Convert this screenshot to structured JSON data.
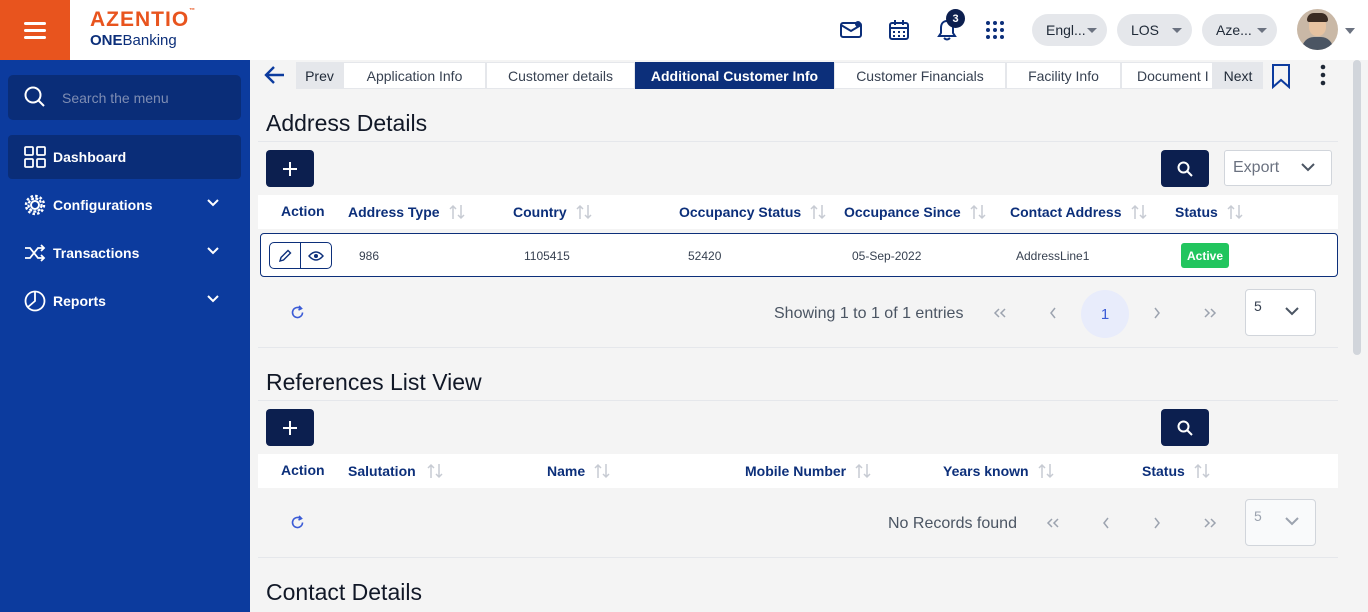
{
  "brand": {
    "logo": "AZENTIO",
    "tm": "™",
    "sub_bold": "ONE",
    "sub_rest": "Banking"
  },
  "header": {
    "notification_count": "3",
    "language": "Engl...",
    "module": "LOS",
    "entity": "Aze..."
  },
  "sidebar": {
    "search_placeholder": "Search the menu",
    "items": [
      {
        "label": "Dashboard"
      },
      {
        "label": "Configurations"
      },
      {
        "label": "Transactions"
      },
      {
        "label": "Reports"
      }
    ]
  },
  "tabs": {
    "prev": "Prev",
    "next": "Next",
    "items": [
      {
        "label": "Application Info"
      },
      {
        "label": "Customer details"
      },
      {
        "label": "Additional Customer Info"
      },
      {
        "label": "Customer Financials"
      },
      {
        "label": "Facility Info"
      },
      {
        "label": "Document I"
      }
    ]
  },
  "address": {
    "title": "Address Details",
    "export_label": "Export",
    "columns": [
      "Action",
      "Address Type",
      "Country",
      "Occupancy Status",
      "Occupance Since",
      "Contact Address",
      "Status"
    ],
    "rows": [
      {
        "address_type": "986",
        "country": "1105415",
        "occupancy_status": "52420",
        "occupance_since": "05-Sep-2022",
        "contact_address": "AddressLine1",
        "status": "Active"
      }
    ],
    "pagination_info": "Showing 1 to 1 of 1 entries",
    "current_page": "1",
    "page_size": "5"
  },
  "references": {
    "title": "References List View",
    "columns": [
      "Action",
      "Salutation",
      "Name",
      "Mobile Number",
      "Years known",
      "Status"
    ],
    "empty_text": "No Records found",
    "page_size": "5"
  },
  "contact": {
    "title": "Contact Details"
  },
  "colors": {
    "brand_orange": "#e8541e",
    "sidebar_blue": "#0c3b9e",
    "navy": "#0c2f7a",
    "active_green": "#22c55e"
  }
}
